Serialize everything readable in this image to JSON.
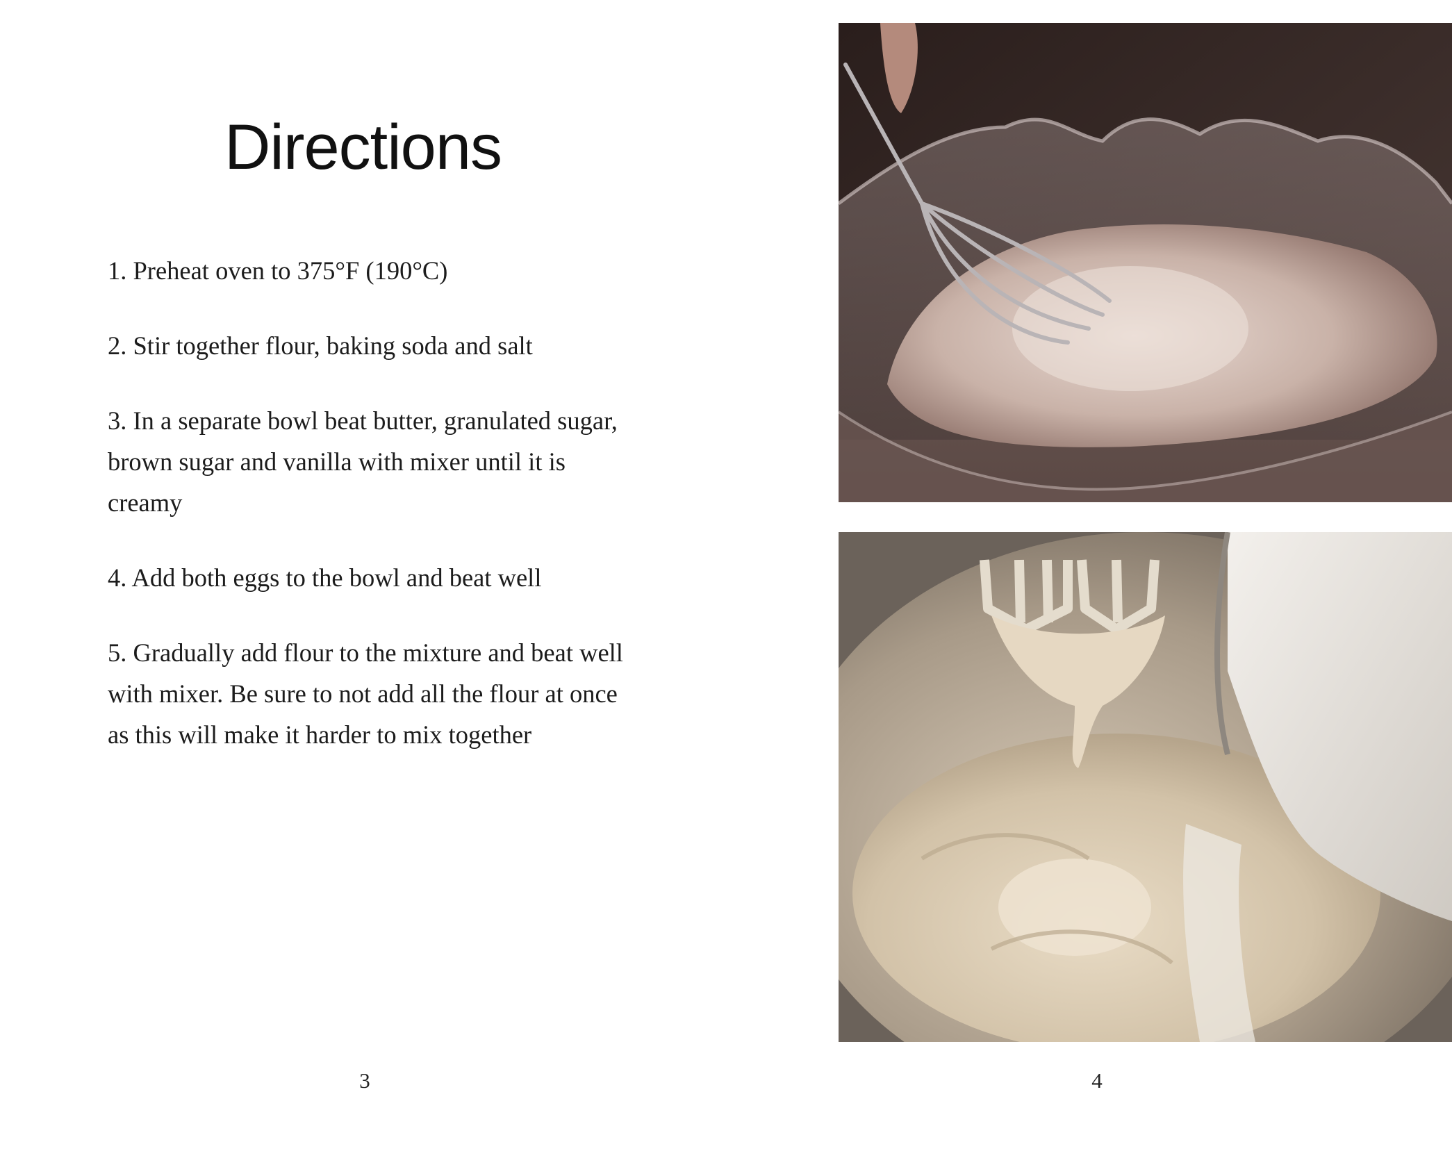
{
  "left_page": {
    "heading": "Directions",
    "steps": [
      "1. Preheat oven to 375°F (190°C)",
      "2. Stir together flour, baking soda and salt",
      "3. In a separate bowl beat butter, granulated sugar, brown sugar and vanilla with mixer until it is creamy",
      "4. Add both eggs to the bowl and beat well",
      "5. Gradually add flour to the mixture and beat well with mixer. Be sure to not add all the flour at once as this will make it harder to mix together"
    ],
    "page_number": "3"
  },
  "right_page": {
    "photos": [
      {
        "subject": "whisking flour in glass bowl"
      },
      {
        "subject": "adding flour to creamed butter mixture with hand mixer"
      }
    ],
    "page_number": "4"
  }
}
